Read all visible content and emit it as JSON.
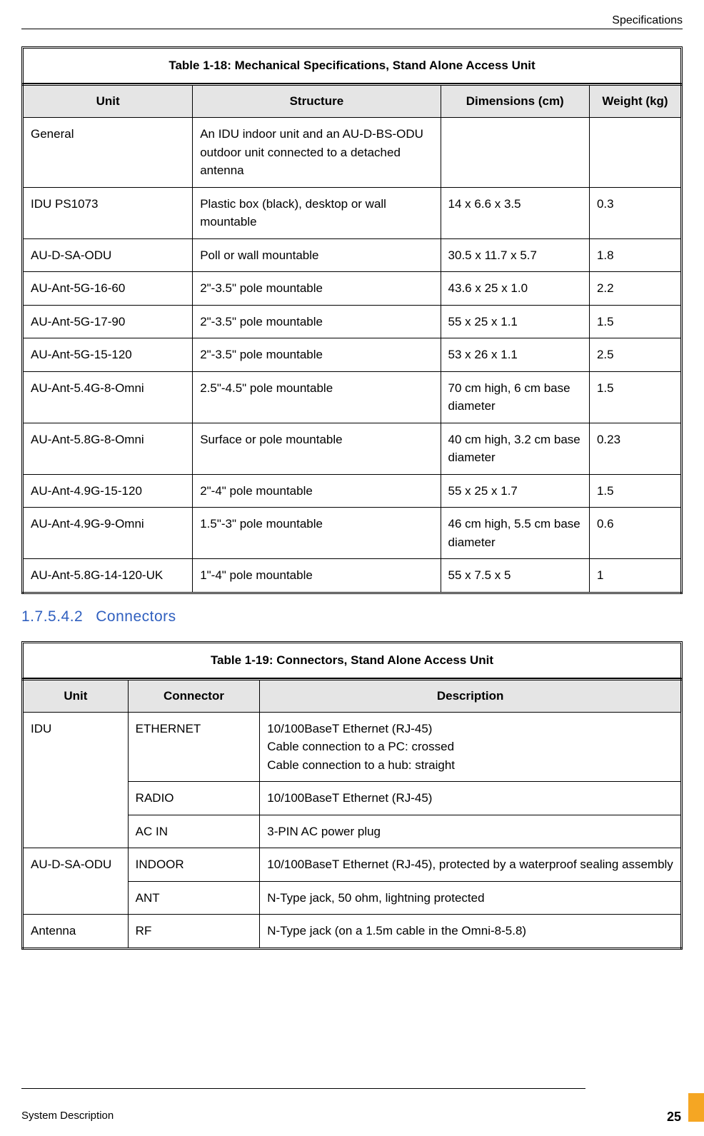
{
  "header": {
    "section": "Specifications"
  },
  "table18": {
    "caption": "Table 1-18: Mechanical Specifications, Stand Alone Access Unit",
    "headers": [
      "Unit",
      "Structure",
      "Dimensions (cm)",
      "Weight (kg)"
    ],
    "rows": [
      {
        "unit": "General",
        "structure": "An IDU indoor unit and an AU-D-BS-ODU outdoor unit connected to a detached antenna",
        "dim": "",
        "wt": ""
      },
      {
        "unit": "IDU PS1073",
        "structure": "Plastic box (black), desktop or wall mountable",
        "dim": "14 x 6.6 x 3.5",
        "wt": "0.3"
      },
      {
        "unit": "AU-D-SA-ODU",
        "structure": "Poll or wall mountable",
        "dim": "30.5 x 11.7 x 5.7",
        "wt": "1.8"
      },
      {
        "unit": "AU-Ant-5G-16-60",
        "structure": "2\"-3.5\" pole mountable",
        "dim": "43.6 x 25 x 1.0",
        "wt": "2.2"
      },
      {
        "unit": "AU-Ant-5G-17-90",
        "structure": "2\"-3.5\" pole mountable",
        "dim": "55 x 25 x 1.1",
        "wt": "1.5"
      },
      {
        "unit": "AU-Ant-5G-15-120",
        "structure": "2\"-3.5\" pole mountable",
        "dim": "53 x 26 x 1.1",
        "wt": "2.5"
      },
      {
        "unit": "AU-Ant-5.4G-8-Omni",
        "structure": "2.5\"-4.5\" pole mountable",
        "dim": "70 cm high, 6 cm base diameter",
        "wt": "1.5"
      },
      {
        "unit": "AU-Ant-5.8G-8-Omni",
        "structure": "Surface or pole mountable",
        "dim": "40 cm high, 3.2 cm base diameter",
        "wt": "0.23"
      },
      {
        "unit": "AU-Ant-4.9G-15-120",
        "structure": "2\"-4\" pole mountable",
        "dim": "55 x 25 x 1.7",
        "wt": "1.5"
      },
      {
        "unit": "AU-Ant-4.9G-9-Omni",
        "structure": "1.5\"-3\" pole mountable",
        "dim": "46 cm high, 5.5 cm base diameter",
        "wt": "0.6"
      },
      {
        "unit": "AU-Ant-5.8G-14-120-UK",
        "structure": "1\"-4\" pole mountable",
        "dim": "55 x 7.5 x 5",
        "wt": "1"
      }
    ]
  },
  "section_heading": {
    "num": "1.7.5.4.2",
    "title": "Connectors"
  },
  "table19": {
    "caption": "Table 1-19: Connectors, Stand Alone Access Unit",
    "headers": [
      "Unit",
      "Connector",
      "Description"
    ],
    "rows": [
      {
        "unit": "IDU",
        "connector": "ETHERNET",
        "desc": "10/100BaseT Ethernet (RJ-45)\nCable connection to a PC: crossed\nCable connection to a hub: straight",
        "rowspan_unit": 3
      },
      {
        "unit": "",
        "connector": "RADIO",
        "desc": "10/100BaseT Ethernet (RJ-45)"
      },
      {
        "unit": "",
        "connector": "AC IN",
        "desc": "3-PIN AC power plug"
      },
      {
        "unit": "AU-D-SA-ODU",
        "connector": "INDOOR",
        "desc": "10/100BaseT Ethernet (RJ-45), protected by a waterproof sealing assembly",
        "rowspan_unit": 2
      },
      {
        "unit": "",
        "connector": "ANT",
        "desc": "N-Type jack, 50 ohm, lightning protected"
      },
      {
        "unit": "Antenna",
        "connector": "RF",
        "desc": "N-Type jack (on a 1.5m cable in the Omni-8-5.8)",
        "rowspan_unit": 1
      }
    ]
  },
  "footer": {
    "left": "System Description",
    "page": "25"
  }
}
